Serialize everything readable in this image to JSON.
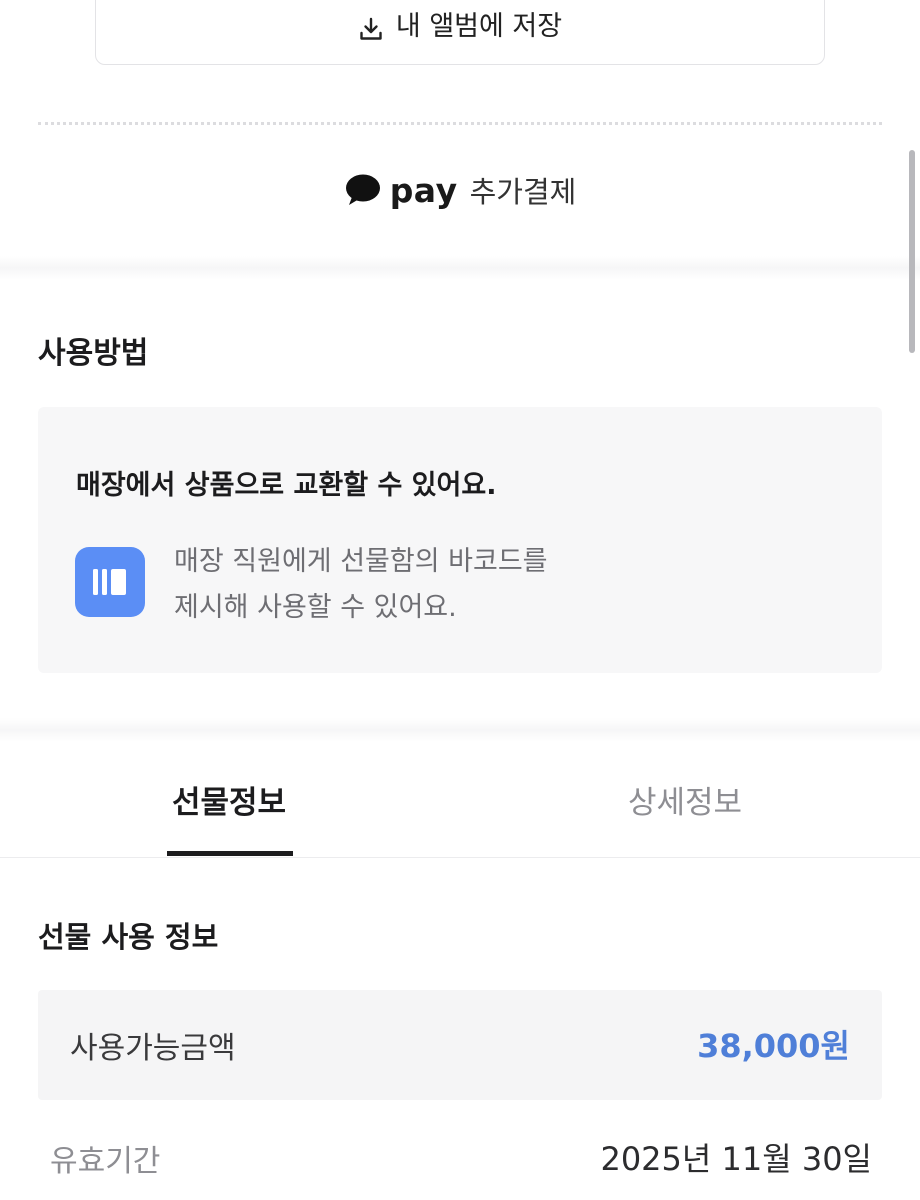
{
  "save_button": {
    "label": "내 앨범에 저장",
    "icon": "download-icon"
  },
  "pay_button": {
    "brand": "pay",
    "label": "추가결제",
    "icon": "speech-bubble-icon"
  },
  "usage": {
    "title": "사용방법",
    "headline": "매장에서 상품으로 교환할 수 있어요.",
    "icon": "barcode-icon",
    "icon_color": "#5b8ef5",
    "description_line1": "매장 직원에게 선물함의 바코드를",
    "description_line2": "제시해 사용할 수 있어요."
  },
  "tabs": {
    "gift_info": "선물정보",
    "detail_info": "상세정보",
    "active": "gift_info"
  },
  "gift_info": {
    "title": "선물 사용 정보",
    "available_amount_label": "사용가능금액",
    "available_amount_value": "38,000원",
    "amount_color": "#4f7fd8",
    "expiry_label": "유효기간",
    "expiry_value": "2025년 11월 30일"
  }
}
